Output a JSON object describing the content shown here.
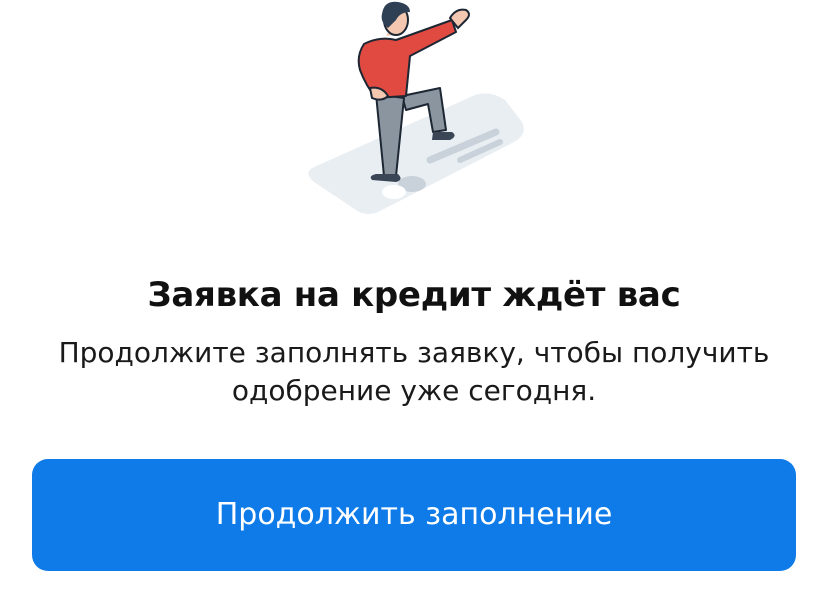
{
  "illustration": {
    "icon": "person-stepping-on-card-icon",
    "colors": {
      "card": "#e9eef3",
      "shirt": "#e04a40",
      "pants": "#8b95a0",
      "skin": "#f4c7b0",
      "hair": "#2f3f54",
      "outline": "#1d2733"
    }
  },
  "title": "Заявка на кредит ждёт вас",
  "subtitle_line1": "Продолжите заполнять заявку, чтобы получить",
  "subtitle_line2": "одобрение уже сегодня.",
  "button": {
    "label": "Продолжить заполнение",
    "color": "#0f7be8"
  }
}
